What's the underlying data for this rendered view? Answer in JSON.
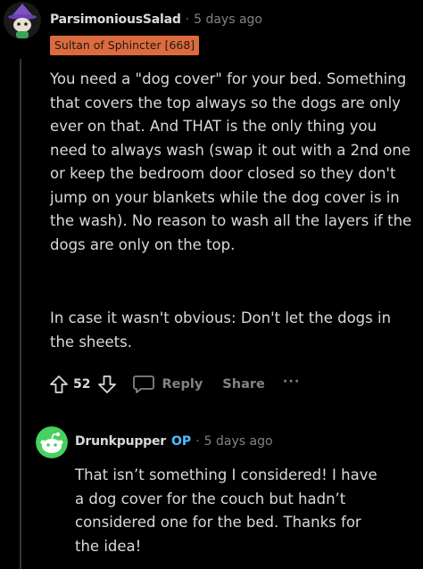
{
  "comment": {
    "username": "ParsimoniousSalad",
    "separator": "·",
    "time": "5 days ago",
    "flair": "Sultan of Sphincter [668]",
    "paragraph1": "You need a \"dog cover\" for your bed. Something that covers the top always so the dogs are only ever on that. And THAT is the only thing you need to always wash (swap it out with a 2nd one or keep the bedroom door closed so they don't jump on your blankets while the dog cover is in the wash). No reason to wash all the layers if the dogs are only on the top.",
    "paragraph2": "In case it wasn't obvious: Don't let the dogs in the sheets.",
    "score": "52",
    "reply_label": "Reply",
    "share_label": "Share",
    "more_label": "···"
  },
  "reply": {
    "username": "Drunkpupper",
    "op_label": "OP",
    "separator": "·",
    "time": "5 days ago",
    "text": "That isn’t something I considered! I have a dog cover for the couch but hadn’t considered one for the bed. Thanks for the idea!"
  },
  "colors": {
    "background": "#000000",
    "flair_bg": "#dd6b3d",
    "op_blue": "#4fbcff",
    "muted": "#818384",
    "text": "#d7dadc"
  },
  "icons": {
    "upvote": "arrow-up-outline",
    "downvote": "arrow-down-outline",
    "reply": "speech-bubble",
    "more": "horizontal-dots"
  }
}
